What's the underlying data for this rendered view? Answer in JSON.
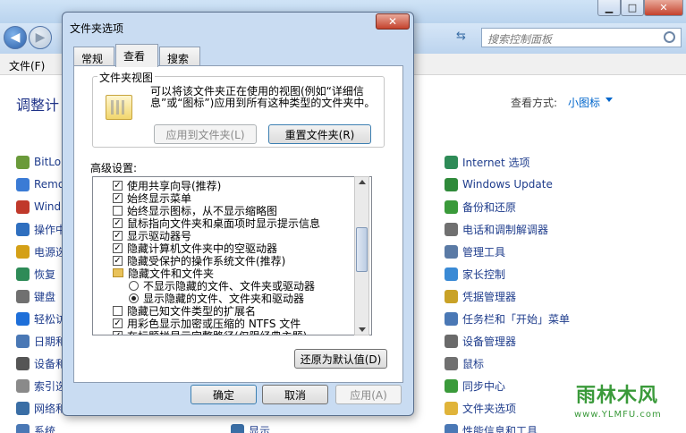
{
  "control_panel": {
    "search_placeholder": "搜索控制面板",
    "menu_file": "文件(F)",
    "heading": "调整计",
    "view_by_label": "查看方式:",
    "view_by_value": "小图标",
    "window_controls": {
      "minimize": "▁",
      "maximize": "□",
      "close": "✕"
    },
    "left_items": [
      {
        "label": "BitLo",
        "color": "#6a9a3a",
        "icon": "bitlocker-icon"
      },
      {
        "label": "Remo",
        "color": "#3a7bd5",
        "icon": "remote-icon"
      },
      {
        "label": "Wind",
        "color": "#c0392b",
        "icon": "windows-icon"
      },
      {
        "label": "操作中",
        "color": "#2f6fbf",
        "icon": "flag-icon"
      },
      {
        "label": "电源选",
        "color": "#d4a017",
        "icon": "power-icon"
      },
      {
        "label": "恢复",
        "color": "#2e8b57",
        "icon": "recovery-icon"
      },
      {
        "label": "键盘",
        "color": "#707070",
        "icon": "keyboard-icon"
      },
      {
        "label": "轻松访",
        "color": "#1e6fd9",
        "icon": "ease-access-icon"
      },
      {
        "label": "日期和",
        "color": "#4a78b5",
        "icon": "clock-icon"
      },
      {
        "label": "设备和",
        "color": "#555555",
        "icon": "printer-icon"
      },
      {
        "label": "索引选",
        "color": "#8a8a8a",
        "icon": "index-icon"
      },
      {
        "label": "网络和",
        "color": "#3a6ea5",
        "icon": "network-icon"
      },
      {
        "label": "系统",
        "color": "#4a78b5",
        "icon": "system-icon"
      }
    ],
    "right_items": [
      {
        "label": "Internet 选项",
        "color": "#2e8b57",
        "icon": "internet-icon"
      },
      {
        "label": "Windows Update",
        "color": "#2f8a3a",
        "icon": "update-icon"
      },
      {
        "label": "备份和还原",
        "color": "#3a9a3a",
        "icon": "backup-icon"
      },
      {
        "label": "电话和调制解调器",
        "color": "#707070",
        "icon": "phone-icon"
      },
      {
        "label": "管理工具",
        "color": "#5a7aa5",
        "icon": "admin-tools-icon"
      },
      {
        "label": "家长控制",
        "color": "#3a8ad5",
        "icon": "parental-icon"
      },
      {
        "label": "凭据管理器",
        "color": "#c9a227",
        "icon": "credential-icon"
      },
      {
        "label": "任务栏和「开始」菜单",
        "color": "#4a78b5",
        "icon": "taskbar-icon"
      },
      {
        "label": "设备管理器",
        "color": "#6a6a6a",
        "icon": "device-manager-icon"
      },
      {
        "label": "鼠标",
        "color": "#707070",
        "icon": "mouse-icon"
      },
      {
        "label": "同步中心",
        "color": "#3a9a3a",
        "icon": "sync-icon"
      },
      {
        "label": "文件夹选项",
        "color": "#e0b43a",
        "icon": "folder-icon"
      },
      {
        "label": "性能信息和工具",
        "color": "#4a78b5",
        "icon": "performance-icon"
      }
    ],
    "mid_item": {
      "label": "显示",
      "color": "#3a6ea5",
      "icon": "display-icon"
    }
  },
  "watermark": {
    "title": "雨林木风",
    "url": "www.YLMFU.com"
  },
  "dialog": {
    "title": "文件夹选项",
    "close": "✕",
    "tabs": [
      "常规",
      "查看",
      "搜索"
    ],
    "folder_views": {
      "legend": "文件夹视图",
      "description": "可以将该文件夹正在使用的视图(例如“详细信息”或“图标”)应用到所有这种类型的文件夹中。",
      "apply_to_folders": "应用到文件夹(L)",
      "reset_folders": "重置文件夹(R)"
    },
    "advanced_label": "高级设置:",
    "advanced_items": [
      {
        "type": "check",
        "checked": true,
        "label": "使用共享向导(推荐)"
      },
      {
        "type": "check",
        "checked": true,
        "label": "始终显示菜单"
      },
      {
        "type": "check",
        "checked": false,
        "label": "始终显示图标，从不显示缩略图"
      },
      {
        "type": "check",
        "checked": true,
        "label": "鼠标指向文件夹和桌面项时显示提示信息"
      },
      {
        "type": "check",
        "checked": true,
        "label": "显示驱动器号"
      },
      {
        "type": "check",
        "checked": true,
        "label": "隐藏计算机文件夹中的空驱动器"
      },
      {
        "type": "check",
        "checked": true,
        "label": "隐藏受保护的操作系统文件(推荐)"
      },
      {
        "type": "folder",
        "label": "隐藏文件和文件夹"
      },
      {
        "type": "radio",
        "checked": false,
        "label": "不显示隐藏的文件、文件夹或驱动器"
      },
      {
        "type": "radio",
        "checked": true,
        "label": "显示隐藏的文件、文件夹和驱动器"
      },
      {
        "type": "check",
        "checked": false,
        "label": "隐藏已知文件类型的扩展名"
      },
      {
        "type": "check",
        "checked": true,
        "label": "用彩色显示加密或压缩的 NTFS 文件"
      },
      {
        "type": "check",
        "checked": true,
        "label": "在标题栏显示完整路径(仅限经典主题)"
      }
    ],
    "restore_defaults": "还原为默认值(D)",
    "ok": "确定",
    "cancel": "取消",
    "apply": "应用(A)"
  }
}
